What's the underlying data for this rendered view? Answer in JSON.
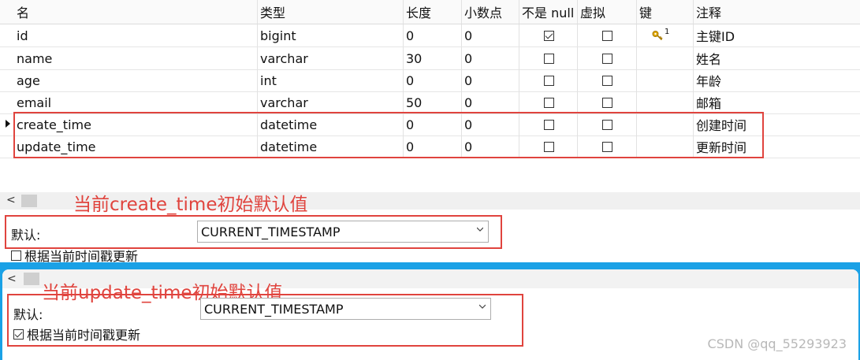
{
  "columns": {
    "name": "名",
    "type": "类型",
    "length": "长度",
    "decimals": "小数点",
    "not_null": "不是 null",
    "virtual": "虚拟",
    "key": "键",
    "comment": "注释"
  },
  "rows": [
    {
      "name": "id",
      "type": "bigint",
      "length": "0",
      "decimals": "0",
      "not_null": true,
      "virtual": false,
      "key": "1",
      "comment": "主键ID"
    },
    {
      "name": "name",
      "type": "varchar",
      "length": "30",
      "decimals": "0",
      "not_null": false,
      "virtual": false,
      "key": "",
      "comment": "姓名"
    },
    {
      "name": "age",
      "type": "int",
      "length": "0",
      "decimals": "0",
      "not_null": false,
      "virtual": false,
      "key": "",
      "comment": "年龄"
    },
    {
      "name": "email",
      "type": "varchar",
      "length": "50",
      "decimals": "0",
      "not_null": false,
      "virtual": false,
      "key": "",
      "comment": "邮箱"
    },
    {
      "name": "create_time",
      "type": "datetime",
      "length": "0",
      "decimals": "0",
      "not_null": false,
      "virtual": false,
      "key": "",
      "comment": "创建时间"
    },
    {
      "name": "update_time",
      "type": "datetime",
      "length": "0",
      "decimals": "0",
      "not_null": false,
      "virtual": false,
      "key": "",
      "comment": "更新时间"
    }
  ],
  "annotations": {
    "create": "当前create_time初始默认值",
    "update": "当前update_time初始默认值"
  },
  "create_panel": {
    "default_label": "默认:",
    "default_value": "CURRENT_TIMESTAMP",
    "on_update_label": "根据当前时间戳更新",
    "on_update_checked": false
  },
  "update_panel": {
    "default_label": "默认:",
    "default_value": "CURRENT_TIMESTAMP",
    "on_update_label": "根据当前时间戳更新",
    "on_update_checked": true
  },
  "scroll_left_glyph": "<",
  "watermark": "CSDN @qq_55293923",
  "colors": {
    "accent_red": "#e0443e",
    "frame_blue": "#1aa1e6"
  }
}
